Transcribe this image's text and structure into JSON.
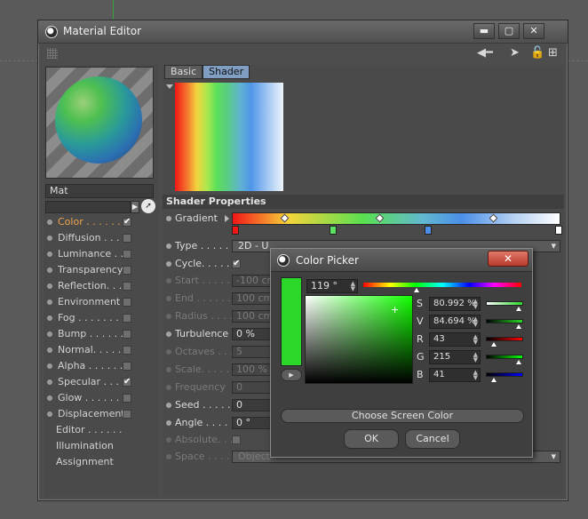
{
  "window": {
    "title": "Material Editor",
    "minimize": "▬",
    "maximize": "▢",
    "close": "✕"
  },
  "toolbar": {
    "icons": [
      "back-arrow-icon",
      "arrow-cursor-icon",
      "lock-icon",
      "new-window-icon"
    ]
  },
  "material": {
    "name": "Mat"
  },
  "channels": [
    {
      "label": "Color . . . . . .",
      "checked": true,
      "active": true
    },
    {
      "label": "Diffusion . . . .",
      "checked": false
    },
    {
      "label": "Luminance . . .",
      "checked": false
    },
    {
      "label": "Transparency",
      "checked": false
    },
    {
      "label": "Reflection. . . .",
      "checked": false
    },
    {
      "label": "Environment",
      "checked": false
    },
    {
      "label": "Fog . . . . . . . .",
      "checked": false
    },
    {
      "label": "Bump . . . . . .",
      "checked": false
    },
    {
      "label": "Normal. . . . . .",
      "checked": false
    },
    {
      "label": "Alpha . . . . . .",
      "checked": false
    },
    {
      "label": "Specular . . . .",
      "checked": true
    },
    {
      "label": "Glow . . . . . . .",
      "checked": false
    },
    {
      "label": "Displacement",
      "checked": false
    }
  ],
  "extra_items": [
    "Editor . . . . . .",
    "Illumination",
    "Assignment"
  ],
  "tabs": [
    "Basic",
    "Shader"
  ],
  "shader": {
    "section": "Shader Properties",
    "gradient_label": "Gradient",
    "type_label": "Type . . . . .",
    "type_value": "2D - U",
    "cycle_label": "Cycle. . . . .",
    "start_label": "Start . . . . .",
    "start_value": "-100 cm",
    "end_label": "End . . . . . .",
    "end_value": "100 cm",
    "radius_label": "Radius . . . .",
    "radius_value": "100 cm",
    "turbulence_label": "Turbulence",
    "turbulence_value": "0 %",
    "octaves_label": "Octaves . . .",
    "octaves_value": "5",
    "scale_label": "Scale. . . . . .",
    "scale_value": "100 %",
    "frequency_label": "Frequency",
    "frequency_value": "0",
    "seed_label": "Seed . . . . .",
    "seed_value": "0",
    "angle_label": "Angle . . . . .",
    "angle_value": "0 °",
    "absolute_label": "Absolute. . .",
    "space_label": "Space . . . . .",
    "space_value": "Object"
  },
  "color_picker": {
    "title": "Color Picker",
    "hue": "119 °",
    "s_label": "S",
    "s_value": "80.992 %",
    "v_label": "V",
    "v_value": "84.694 %",
    "r_label": "R",
    "r_value": "43",
    "g_label": "G",
    "g_value": "215",
    "b_label": "B",
    "b_value": "41",
    "choose_screen": "Choose Screen Color",
    "ok": "OK",
    "cancel": "Cancel",
    "color_hex": "#2bd729"
  }
}
